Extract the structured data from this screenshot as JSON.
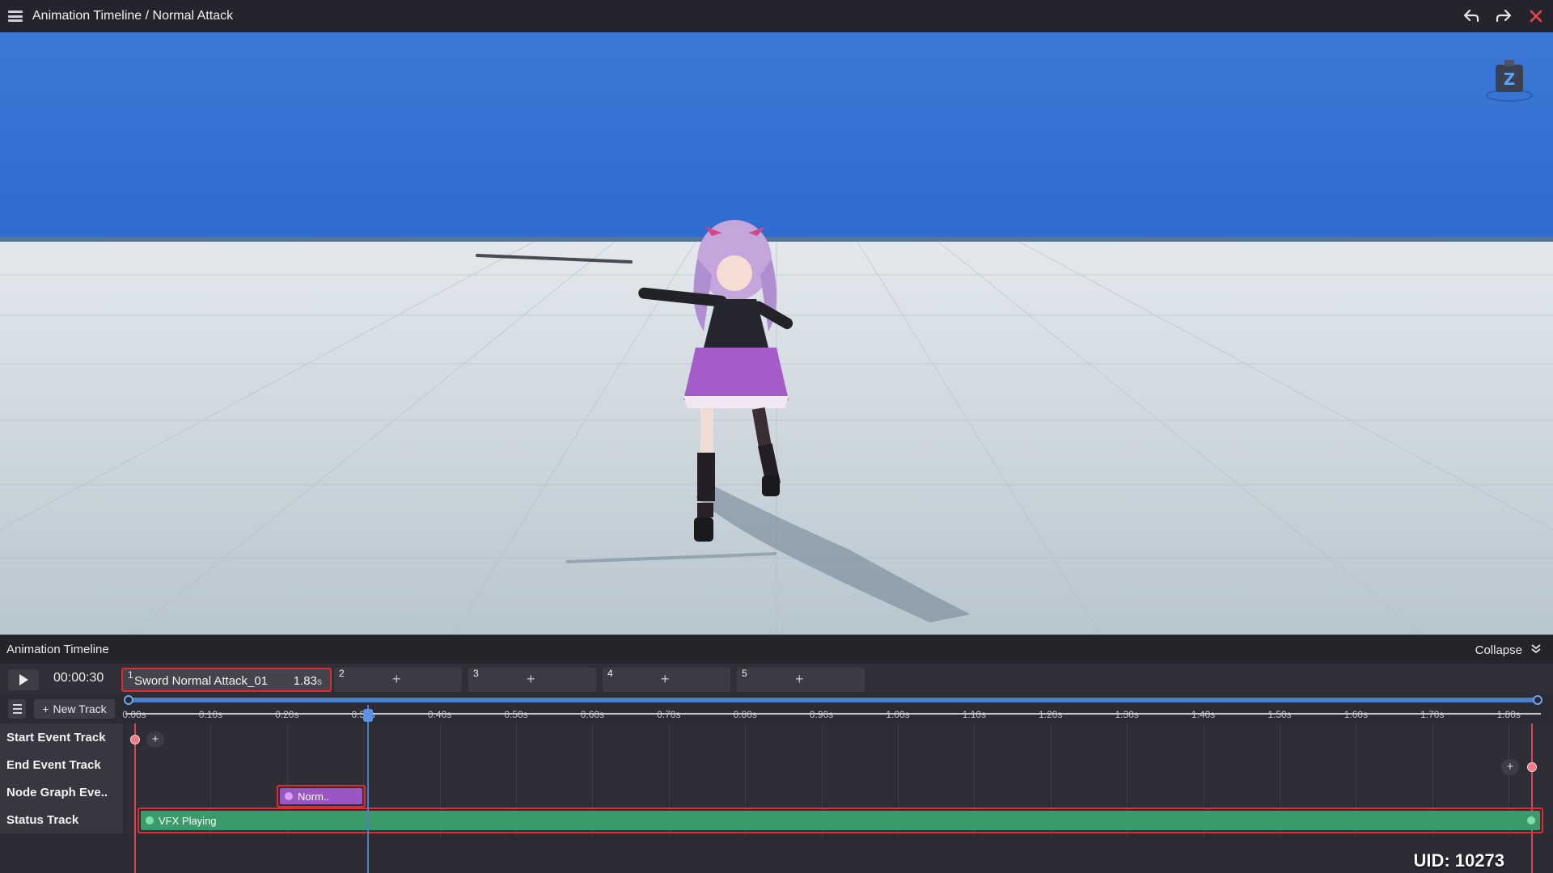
{
  "window": {
    "title": "Animation Timeline / Normal Attack",
    "icons": [
      "menu-icon",
      "undo-icon",
      "redo-icon",
      "close-icon"
    ]
  },
  "viewport": {
    "sky_color": "#3f7bd8",
    "floor_color": "#c9d3d9"
  },
  "panel": {
    "title": "Animation Timeline",
    "collapse_label": "Collapse"
  },
  "toolbar": {
    "timecode": "00:00:30",
    "clips": [
      {
        "num": "1",
        "name": "Sword Normal Attack_01",
        "duration": "1.83",
        "unit": "s",
        "active": true
      },
      {
        "num": "2",
        "plus": "+"
      },
      {
        "num": "3",
        "plus": "+"
      },
      {
        "num": "4",
        "plus": "+"
      },
      {
        "num": "5",
        "plus": "+"
      }
    ],
    "new_track_label": "New Track",
    "new_track_plus": "+"
  },
  "ruler": {
    "ticks": [
      "0.00s",
      "0.10s",
      "0.20s",
      "0.30s",
      "0.40s",
      "0.50s",
      "0.60s",
      "0.70s",
      "0.80s",
      "0.90s",
      "1.00s",
      "1.10s",
      "1.20s",
      "1.30s",
      "1.40s",
      "1.50s",
      "1.60s",
      "1.70s",
      "1.80s"
    ],
    "playhead_time": 0.3,
    "end_time": 1.83
  },
  "tracks": [
    {
      "label": "Start Event Track"
    },
    {
      "label": "End Event Track"
    },
    {
      "label": "Node Graph Eve.."
    },
    {
      "label": "Status Track"
    }
  ],
  "clips_on_tracks": {
    "node_graph_clip": "Norm..",
    "status_clip": "VFX Playing",
    "event_plus": "+"
  },
  "uid": "UID: 10273",
  "colors": {
    "accent_red": "#e8262e",
    "playhead_blue": "#4b7fc7",
    "status_green": "#3a9a6a",
    "node_purple": "#9b56c4"
  }
}
